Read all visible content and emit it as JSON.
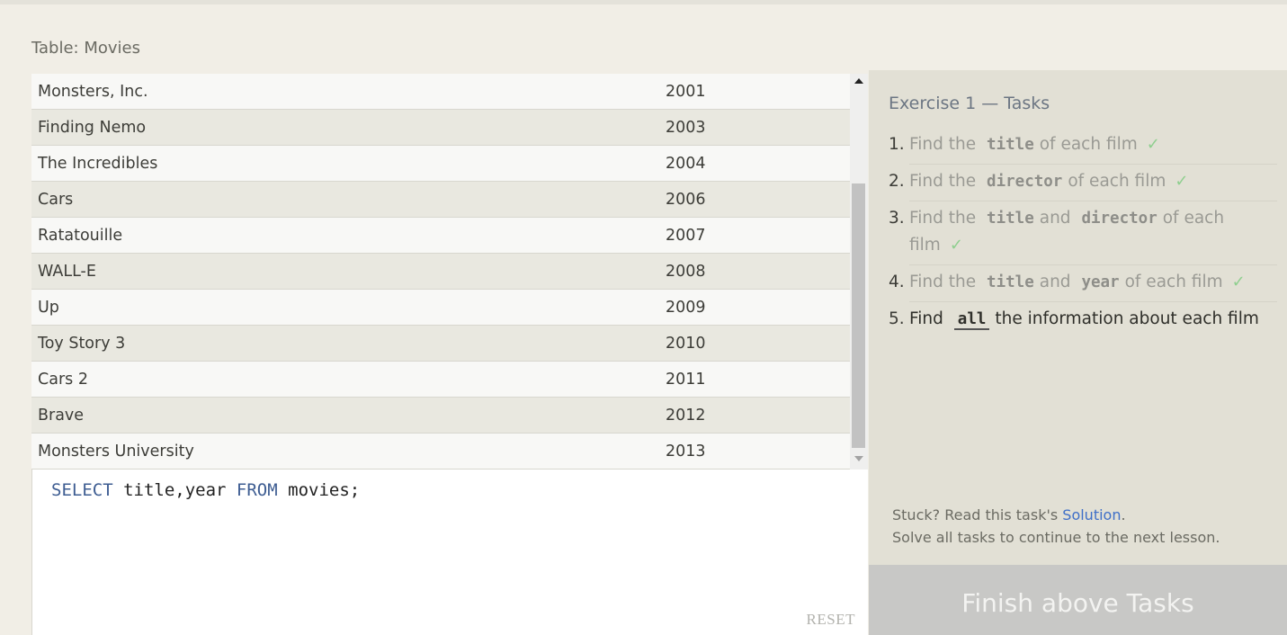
{
  "table": {
    "title": "Table: Movies",
    "rows": [
      {
        "title": "Monsters, Inc.",
        "year": "2001"
      },
      {
        "title": "Finding Nemo",
        "year": "2003"
      },
      {
        "title": "The Incredibles",
        "year": "2004"
      },
      {
        "title": "Cars",
        "year": "2006"
      },
      {
        "title": "Ratatouille",
        "year": "2007"
      },
      {
        "title": "WALL-E",
        "year": "2008"
      },
      {
        "title": "Up",
        "year": "2009"
      },
      {
        "title": "Toy Story 3",
        "year": "2010"
      },
      {
        "title": "Cars 2",
        "year": "2011"
      },
      {
        "title": "Brave",
        "year": "2012"
      },
      {
        "title": "Monsters University",
        "year": "2013"
      }
    ]
  },
  "editor": {
    "kw_select": "SELECT",
    "columns": " title,year ",
    "kw_from": "FROM",
    "table": " movies;",
    "reset_label": "RESET"
  },
  "tasks": {
    "heading": "Exercise 1 — Tasks",
    "items": [
      {
        "num": "1.",
        "pre": "Find the",
        "code1": "title",
        "mid": "",
        "code2": "",
        "post": "of each film",
        "check": "✓"
      },
      {
        "num": "2.",
        "pre": "Find the",
        "code1": "director",
        "mid": "",
        "code2": "",
        "post": "of each film",
        "check": "✓"
      },
      {
        "num": "3.",
        "pre": "Find the",
        "code1": "title",
        "mid": "and",
        "code2": "director",
        "post": "of each film",
        "check": "✓"
      },
      {
        "num": "4.",
        "pre": "Find the",
        "code1": "title",
        "mid": "and",
        "code2": "year",
        "post": "of each film",
        "check": "✓"
      },
      {
        "num": "5.",
        "pre": "Find",
        "code1": "all",
        "mid": "",
        "code2": "",
        "post": "the information about each film",
        "check": ""
      }
    ],
    "stuck_text": "Stuck? Read this task's ",
    "solution_label": "Solution",
    "stuck_end": ".",
    "continue_text": "Solve all tasks to continue to the next lesson."
  },
  "finish_label": "Finish above Tasks",
  "colors": {
    "keyword": "#3e5d92",
    "check": "#8fcf8f",
    "link": "#3f6fc8",
    "finish_bg": "#c8c8c6"
  }
}
